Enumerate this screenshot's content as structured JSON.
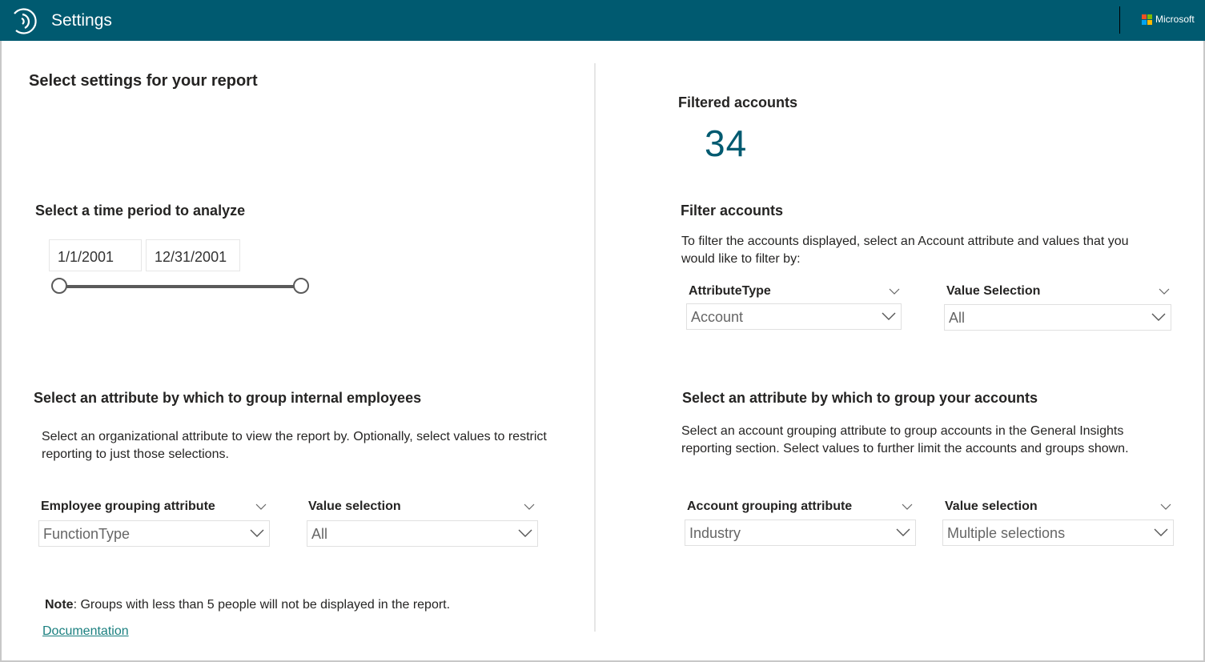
{
  "header": {
    "title": "Settings",
    "brand": "Microsoft",
    "brand_colors": [
      "#f25022",
      "#7fba00",
      "#00a4ef",
      "#ffb900"
    ],
    "bar_color": "#005a70"
  },
  "left": {
    "page_heading": "Select settings for your report",
    "time_period": {
      "heading": "Select a time period to analyze",
      "start_date": "1/1/2001",
      "end_date": "12/31/2001",
      "slider_range": [
        0,
        1
      ]
    },
    "employee_group": {
      "heading": "Select an attribute by which to group internal employees",
      "description": "Select an organizational attribute to view the report by. Optionally, select values to restrict reporting to just those selections.",
      "attribute_slicer": {
        "label": "Employee grouping attribute",
        "value": "FunctionType"
      },
      "value_slicer": {
        "label": "Value selection",
        "value": "All"
      }
    },
    "note": {
      "bold": "Note",
      "text": ": Groups with less than 5 people will not be displayed in the report."
    },
    "documentation_link": "Documentation"
  },
  "right": {
    "filtered_accounts": {
      "label": "Filtered accounts",
      "value": "34",
      "color": "#005a70"
    },
    "filter_accounts": {
      "heading": "Filter accounts",
      "description": "To filter the accounts displayed, select an Account attribute and values that you would like to filter by:",
      "attribute_slicer": {
        "label": "AttributeType",
        "value": "Account"
      },
      "value_slicer": {
        "label": "Value Selection",
        "value": "All"
      }
    },
    "account_group": {
      "heading": "Select an attribute by which to group your accounts",
      "description": "Select an account grouping attribute to group accounts in the General Insights reporting section.  Select values to further limit the accounts and groups shown.",
      "attribute_slicer": {
        "label": "Account grouping attribute",
        "value": "Industry"
      },
      "value_slicer": {
        "label": "Value selection",
        "value": "Multiple selections"
      }
    }
  }
}
